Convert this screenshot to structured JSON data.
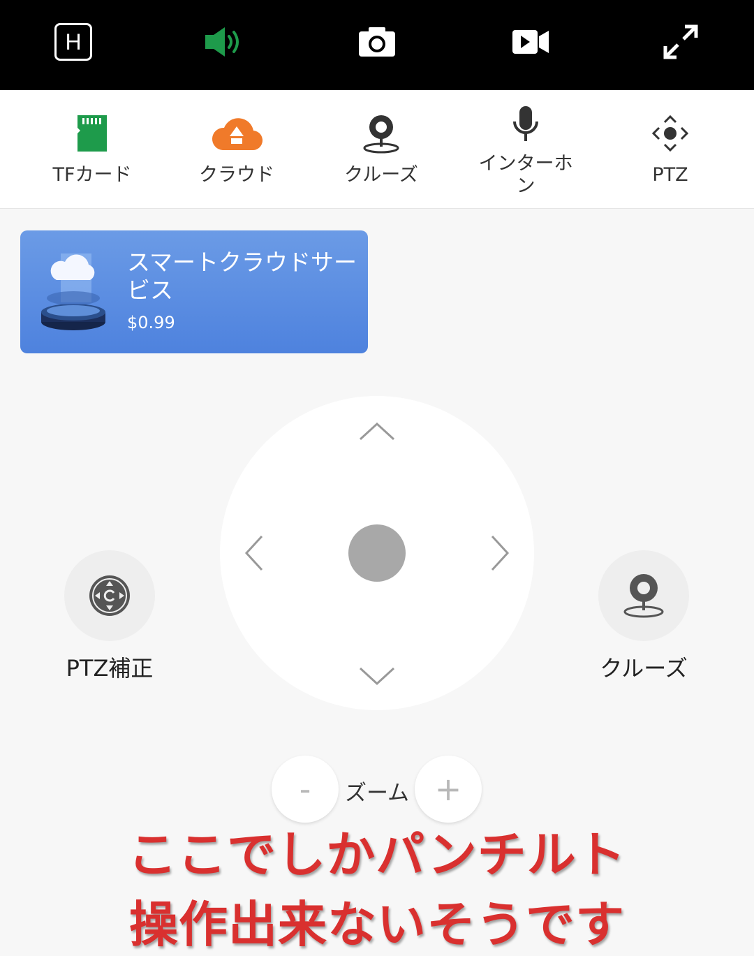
{
  "topbar": {
    "quality_label": "H",
    "buttons": [
      "hq-toggle",
      "speaker",
      "snapshot",
      "record",
      "fullscreen"
    ],
    "speaker_color": "#1e9b4b"
  },
  "toolbar": {
    "items": [
      {
        "label": "TFカード",
        "icon": "sd-card-icon"
      },
      {
        "label": "クラウド",
        "icon": "cloud-upload-icon"
      },
      {
        "label": "クルーズ",
        "icon": "cruise-camera-icon"
      },
      {
        "label": "インターホ\nン",
        "icon": "microphone-icon"
      },
      {
        "label": "PTZ",
        "icon": "ptz-icon"
      }
    ]
  },
  "banner": {
    "title": "スマートクラウドサービス",
    "price": "$0.99"
  },
  "ptz": {
    "left_label": "PTZ補正",
    "right_label": "クルーズ"
  },
  "zoom": {
    "label": "ズーム",
    "minus": "-",
    "plus": "+"
  },
  "overlay": {
    "line1": "ここでしかパンチルト",
    "line2": "操作出来ないそうです"
  },
  "colors": {
    "accent_green": "#1e9b4b",
    "cloud_orange": "#f07a2a",
    "banner_blue": "#5a8ce0",
    "overlay_red": "#d9302f"
  }
}
